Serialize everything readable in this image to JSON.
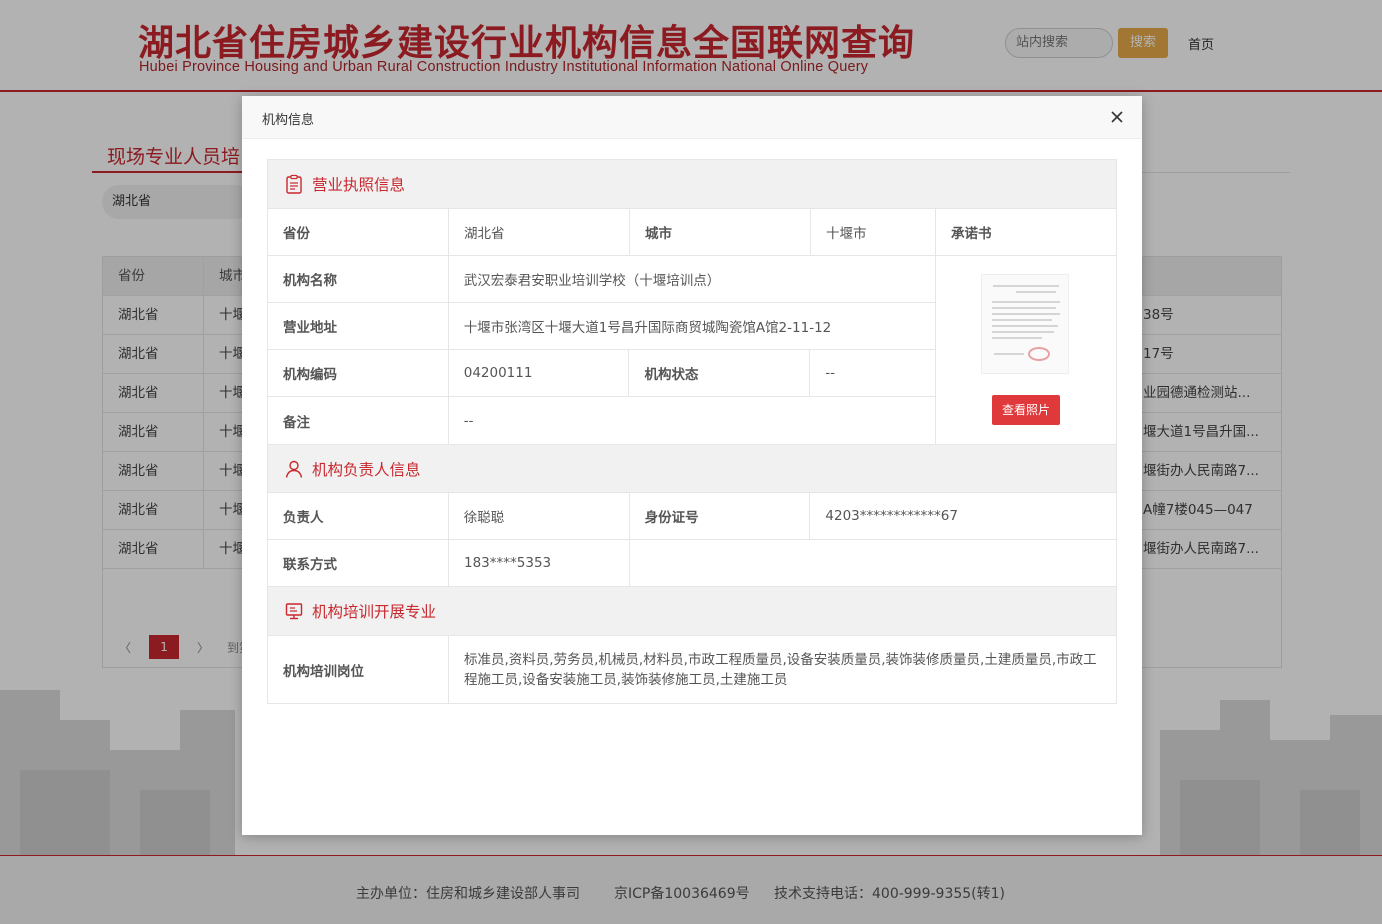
{
  "header": {
    "title": "湖北省住房城乡建设行业机构信息全国联网查询",
    "subtitle": "Hubei Province Housing and Urban Rural Construction Industry Institutional Information National Online Query",
    "search_placeholder": "站内搜索",
    "search_button": "搜索",
    "home_link": "首页"
  },
  "background": {
    "section_title": "现场专业人员培",
    "province_select": "湖北省",
    "table_headers": [
      "省份",
      "城市"
    ],
    "rows": [
      {
        "province": "湖北省",
        "city": "十堰",
        "tail": "38号"
      },
      {
        "province": "湖北省",
        "city": "十堰",
        "tail": "17号"
      },
      {
        "province": "湖北省",
        "city": "十堰",
        "tail": "业园德通检测站..."
      },
      {
        "province": "湖北省",
        "city": "十堰",
        "tail": "堰大道1号昌升国..."
      },
      {
        "province": "湖北省",
        "city": "十堰",
        "tail": "堰街办人民南路7..."
      },
      {
        "province": "湖北省",
        "city": "十堰",
        "tail": "A幢7楼045—047"
      },
      {
        "province": "湖北省",
        "city": "十堰",
        "tail": "堰街办人民南路7..."
      }
    ],
    "pager": {
      "prev": "〈",
      "current": "1",
      "next": "〉",
      "goto": "到第"
    }
  },
  "footer": {
    "host": "主办单位：住房和城乡建设部人事司",
    "icp": "京ICP备10036469号",
    "support": "技术支持电话：400-999-9355(转1)"
  },
  "modal": {
    "title": "机构信息",
    "license": {
      "heading": "营业执照信息",
      "province_label": "省份",
      "province_value": "湖北省",
      "city_label": "城市",
      "city_value": "十堰市",
      "commitment_label": "承诺书",
      "name_label": "机构名称",
      "name_value": "武汉宏泰君安职业培训学校（十堰培训点）",
      "address_label": "营业地址",
      "address_value": "十堰市张湾区十堰大道1号昌升国际商贸城陶瓷馆A馆2-11-12",
      "code_label": "机构编码",
      "code_value": "04200111",
      "status_label": "机构状态",
      "status_value": "--",
      "remark_label": "备注",
      "remark_value": "--",
      "view_photo_button": "查看照片"
    },
    "principal": {
      "heading": "机构负责人信息",
      "name_label": "负责人",
      "name_value": "徐聪聪",
      "id_label": "身份证号",
      "id_value": "4203************67",
      "contact_label": "联系方式",
      "contact_value": "183****5353"
    },
    "training": {
      "heading": "机构培训开展专业",
      "positions_label": "机构培训岗位",
      "positions_value": "标准员,资料员,劳务员,机械员,材料员,市政工程质量员,设备安装质量员,装饰装修质量员,土建质量员,市政工程施工员,设备安装施工员,装饰装修施工员,土建施工员"
    }
  },
  "colors": {
    "brand_red": "#c8282e",
    "button_red": "#e0393b",
    "search_orange": "#e9a94a"
  }
}
